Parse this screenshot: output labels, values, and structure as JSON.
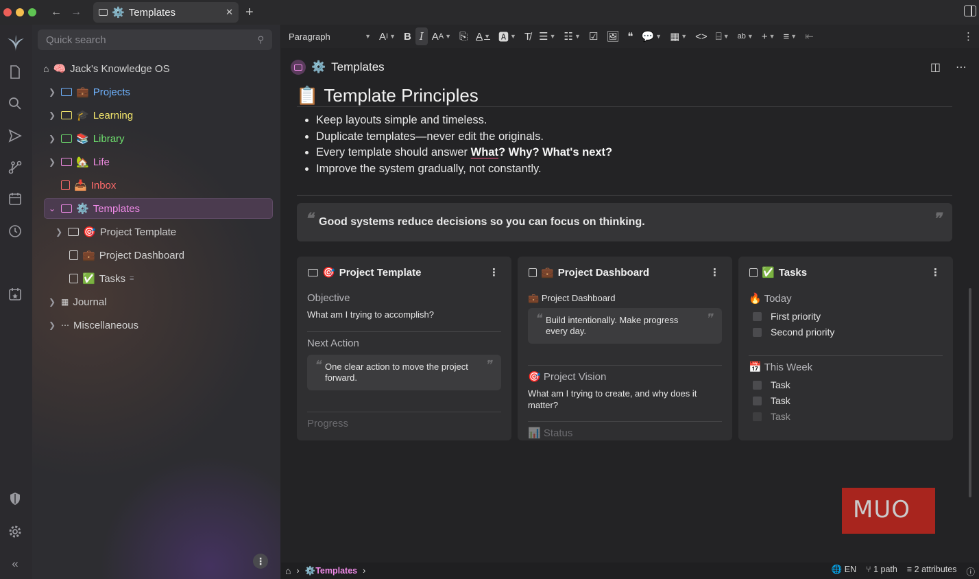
{
  "window": {
    "tab_title": "Templates",
    "tab_icon": "⚙️",
    "close_glyph": "✕",
    "new_tab_glyph": "+"
  },
  "sidebar": {
    "search_placeholder": "Quick search",
    "root": {
      "emoji": "🧠",
      "label": "Jack's Knowledge OS"
    },
    "items": [
      {
        "emoji": "💼",
        "label": "Projects",
        "color": "#6fb3ff"
      },
      {
        "emoji": "🎓",
        "label": "Learning",
        "color": "#f2e56b"
      },
      {
        "emoji": "📚",
        "label": "Library",
        "color": "#6ee06e"
      },
      {
        "emoji": "🏡",
        "label": "Life",
        "color": "#ee8ae0"
      },
      {
        "emoji": "📥",
        "label": "Inbox",
        "color": "#ff6b6b"
      },
      {
        "emoji": "⚙️",
        "label": "Templates",
        "color": "#f08ae8"
      }
    ],
    "children": [
      {
        "emoji": "🎯",
        "label": "Project Template"
      },
      {
        "emoji": "💼",
        "label": "Project Dashboard"
      },
      {
        "emoji": "✅",
        "label": "Tasks"
      }
    ],
    "more_items": [
      {
        "label": "Journal"
      },
      {
        "label": "Miscellaneous"
      }
    ]
  },
  "toolbar": {
    "block_format": "Paragraph"
  },
  "note": {
    "icon": "⚙️",
    "title": "Templates"
  },
  "content": {
    "heading_emoji": "📋",
    "heading": "Template Principles",
    "bullets": [
      "Keep layouts simple and timeless.",
      "Duplicate templates—never edit the originals."
    ],
    "bullet3_prefix": "Every template should answer ",
    "bullet3_what": "What",
    "bullet3_rest": "? Why? What's next?",
    "bullet4": "Improve the system gradually, not constantly.",
    "quote": "Good systems reduce decisions so you can focus on thinking."
  },
  "cards": [
    {
      "emoji": "🎯",
      "title": "Project Template",
      "section1_label": "Objective",
      "section1_text": "What am I trying to accomplish?",
      "section2_label": "Next Action",
      "section2_quote": "One clear action to move the project forward.",
      "section3_label": "Progress"
    },
    {
      "emoji": "💼",
      "title": "Project Dashboard",
      "sub_title": "Project Dashboard",
      "sub_emoji": "💼",
      "quote": "Build intentionally. Make progress every day.",
      "section2_emoji": "🎯",
      "section2_label": "Project Vision",
      "section2_text": "What am I trying to create, and why does it matter?",
      "section3_emoji": "📊",
      "section3_label": "Status"
    },
    {
      "emoji": "✅",
      "title": "Tasks",
      "today_emoji": "🔥",
      "today_label": "Today",
      "today_items": [
        "First priority",
        "Second priority"
      ],
      "week_emoji": "📅",
      "week_label": "This Week",
      "week_items": [
        "Task",
        "Task",
        "Task"
      ]
    }
  ],
  "statusbar": {
    "breadcrumb_emoji": "⚙️",
    "breadcrumb": "Templates",
    "language": "EN",
    "paths": "1 path",
    "attributes": "2 attributes"
  },
  "watermark": "MUO",
  "colors": {
    "accent": "#f08ae8",
    "selected_bg": "#4b3b4f"
  }
}
